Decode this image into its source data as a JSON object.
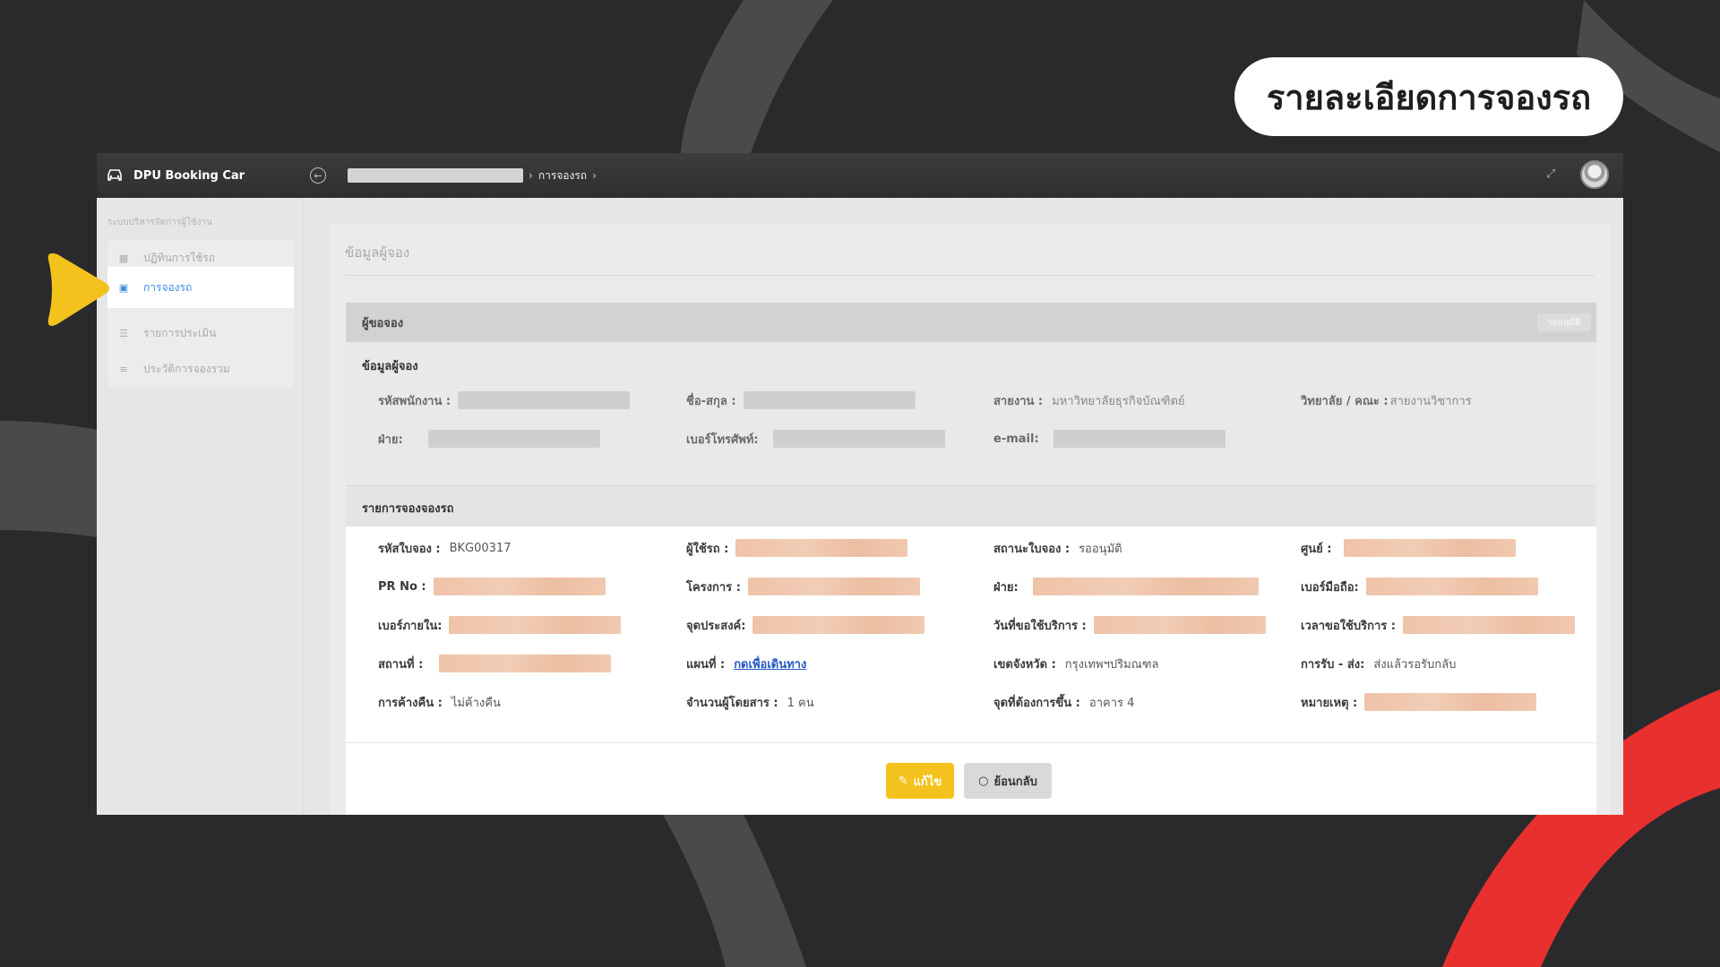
{
  "page_title": "รายละเอียดการจองรถ",
  "app": {
    "brand": "DPU Booking Car",
    "breadcrumb_current": "การจองรถ",
    "breadcrumb_sep": "›"
  },
  "sidebar": {
    "group_label": "ระบบบริหารจัดการผู้ใช้งาน",
    "items": [
      {
        "label": "ปฏิทินการใช้รถ",
        "icon": "calendar-icon"
      },
      {
        "label": "การจองรถ",
        "icon": "book-icon"
      },
      {
        "label": "รายการประเมิน",
        "icon": "list-check-icon"
      },
      {
        "label": "ประวัติการจองรวม",
        "icon": "list-icon"
      }
    ]
  },
  "content": {
    "title": "ข้อมูลผู้จอง",
    "card_title": "ผู้ขอจอง",
    "status": "รออนุมัติ",
    "requester_section": "ข้อมูลผู้จอง",
    "requester": {
      "employee_id_label": "รหัสพนักงาน :",
      "name_label": "ชื่อ-สกุล :",
      "line_label": "สายงาน :",
      "line_value": "มหาวิทยาลัยธุรกิจบัณฑิตย์",
      "faculty_label": "วิทยาลัย / คณะ :",
      "faculty_value": "สายงานวิชาการ",
      "dept_label": "ฝ่าย:",
      "phone_label": "เบอร์โทรศัพท์:",
      "email_label": "e-mail:"
    },
    "booking_section": "รายการจองจองรถ",
    "booking": {
      "booking_id_label": "รหัสใบจอง :",
      "booking_id_value": "BKG00317",
      "user_label": "ผู้ใช้รถ :",
      "status_label": "สถานะใบจอง :",
      "status_value": "รออนุมัติ",
      "center_label": "ศูนย์ :",
      "pr_label": "PR No :",
      "project_label": "โครงการ :",
      "dept_label": "ฝ่าย:",
      "mobile_label": "เบอร์มือถือ:",
      "ext_label": "เบอร์ภายใน:",
      "purpose_label": "จุดประสงค์:",
      "service_date_label": "วันที่ขอใช้บริการ :",
      "service_time_label": "เวลาขอใช้บริการ :",
      "place_label": "สถานที่ :",
      "map_label": "แผนที่ :",
      "map_link": "กดเพื่อเดินทาง",
      "zone_label": "เขตจังหวัด :",
      "zone_value": "กรุงเทพฯปริมณฑล",
      "pickup_label": "การรับ - ส่ง:",
      "pickup_value": "ส่งแล้วรอรับกลับ",
      "overnight_label": "การค้างคืน :",
      "overnight_value": "ไม่ค้างคืน",
      "passengers_label": "จำนวนผู้โดยสาร :",
      "passengers_value": "1 คน",
      "pickup_point_label": "จุดที่ต้องการขึ้น :",
      "pickup_point_value": "อาคาร 4",
      "note_label": "หมายเหตุ :"
    },
    "buttons": {
      "edit": "แก้ไข",
      "back": "ย้อนกลับ"
    }
  },
  "colors": {
    "background": "#2a2a2c",
    "accent_yellow": "#f4c21d",
    "accent_red": "#e8302f",
    "active_link": "#3d8be0"
  }
}
